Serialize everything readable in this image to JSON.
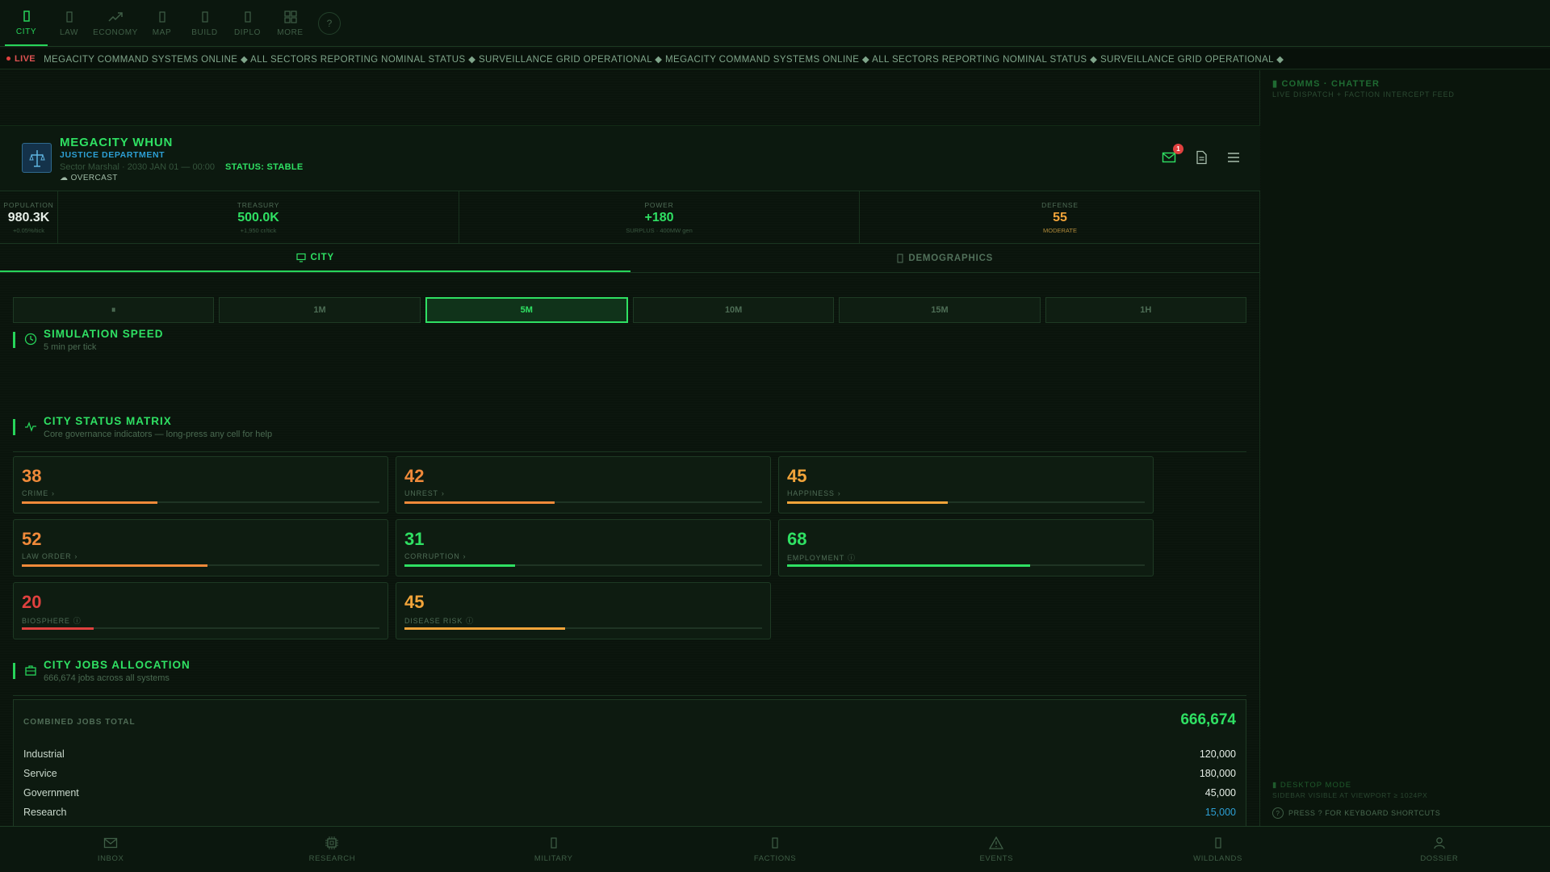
{
  "topnav": {
    "items": [
      {
        "label": "CITY",
        "icon": "city-icon"
      },
      {
        "label": "LAW",
        "icon": "law-icon"
      },
      {
        "label": "ECONOMY",
        "icon": "trend-icon"
      },
      {
        "label": "MAP",
        "icon": "map-icon"
      },
      {
        "label": "BUILD",
        "icon": "build-icon"
      },
      {
        "label": "DIPLO",
        "icon": "diplo-icon"
      },
      {
        "label": "MORE",
        "icon": "grid-icon"
      }
    ],
    "help": "?"
  },
  "ticker": {
    "live_label": "LIVE",
    "text": "MEGACITY COMMAND SYSTEMS ONLINE ◆ ALL SECTORS REPORTING NOMINAL STATUS ◆ SURVEILLANCE GRID OPERATIONAL ◆ MEGACITY COMMAND SYSTEMS ONLINE ◆ ALL SECTORS REPORTING NOMINAL STATUS ◆ SURVEILLANCE GRID OPERATIONAL ◆"
  },
  "header": {
    "city_name": "MEGACITY WHUN",
    "department": "JUSTICE DEPARTMENT",
    "meta": "Sector Marshal · 2030 JAN 01 — 00:00",
    "status": "STATUS: STABLE",
    "weather": "☁ OVERCAST",
    "notifications": "1"
  },
  "stats": [
    {
      "label": "POPULATION",
      "value": "980.3K",
      "sub": "+0.05%/tick",
      "color": "#e6eee7"
    },
    {
      "label": "TREASURY",
      "value": "500.0K",
      "sub": "+1,950 cr/tick",
      "color": "#2fe063"
    },
    {
      "label": "POWER",
      "value": "+180",
      "sub": "SURPLUS · 400MW gen",
      "color": "#2fe063"
    },
    {
      "label": "DEFENSE",
      "value": "55",
      "sub": "MODERATE",
      "color": "#f2a43a"
    }
  ],
  "tabs": [
    {
      "label": "CITY"
    },
    {
      "label": "DEMOGRAPHICS"
    }
  ],
  "speed": {
    "title": "SIMULATION SPEED",
    "subtitle": "5 min per tick",
    "options": [
      "⏸",
      "1M",
      "5M",
      "10M",
      "15M",
      "1H"
    ],
    "selected": "5M"
  },
  "matrix": {
    "title": "CITY STATUS MATRIX",
    "subtitle": "Core governance indicators — long-press any cell for help",
    "cells": [
      {
        "value": "38",
        "label": "CRIME",
        "suffix": "›",
        "level": 0.38,
        "color": "#f08a3a"
      },
      {
        "value": "42",
        "label": "UNREST",
        "suffix": "›",
        "level": 0.42,
        "color": "#f08a3a"
      },
      {
        "value": "45",
        "label": "HAPPINESS",
        "suffix": "›",
        "level": 0.45,
        "color": "#f2a43a"
      },
      {
        "value": "52",
        "label": "LAW ORDER",
        "suffix": "›",
        "level": 0.52,
        "color": "#f08a3a"
      },
      {
        "value": "31",
        "label": "CORRUPTION",
        "suffix": "›",
        "level": 0.31,
        "color": "#2fe063"
      },
      {
        "value": "68",
        "label": "EMPLOYMENT",
        "suffix": "ⓘ",
        "level": 0.68,
        "color": "#2fe063"
      },
      {
        "value": "20",
        "label": "BIOSPHERE",
        "suffix": "ⓘ",
        "level": 0.2,
        "color": "#e0413f"
      },
      {
        "value": "45",
        "label": "DISEASE RISK",
        "suffix": "ⓘ",
        "level": 0.45,
        "color": "#f2a43a"
      }
    ]
  },
  "jobs": {
    "title": "CITY JOBS ALLOCATION",
    "subtitle": "666,674 jobs across all systems",
    "total_label": "COMBINED JOBS TOTAL",
    "total_value": "666,674",
    "rows": [
      {
        "name": "Industrial",
        "value": "120,000",
        "color": "#e6eee7"
      },
      {
        "name": "Service",
        "value": "180,000",
        "color": "#e6eee7"
      },
      {
        "name": "Government",
        "value": "45,000",
        "color": "#e6eee7"
      },
      {
        "name": "Research",
        "value": "15,000",
        "color": "#2d9fd4"
      }
    ]
  },
  "right_panel": {
    "comms_title": "▮ COMMS · CHATTER",
    "comms_subtitle": "LIVE DISPATCH + FACTION INTERCEPT FEED",
    "desktop_title": "▮ DESKTOP MODE",
    "desktop_subtitle": "SIDEBAR VISIBLE AT VIEWPORT ≥ 1024PX",
    "kbd_icon": "?",
    "kbd_hint": "PRESS ? FOR KEYBOARD SHORTCUTS"
  },
  "bottomnav": {
    "items": [
      {
        "label": "INBOX",
        "icon": "mail-icon"
      },
      {
        "label": "RESEARCH",
        "icon": "chip-icon"
      },
      {
        "label": "MILITARY",
        "icon": "military-icon"
      },
      {
        "label": "FACTIONS",
        "icon": "factions-icon"
      },
      {
        "label": "EVENTS",
        "icon": "warning-icon"
      },
      {
        "label": "WILDLANDS",
        "icon": "wildlands-icon"
      },
      {
        "label": "DOSSIER",
        "icon": "person-icon"
      }
    ]
  }
}
